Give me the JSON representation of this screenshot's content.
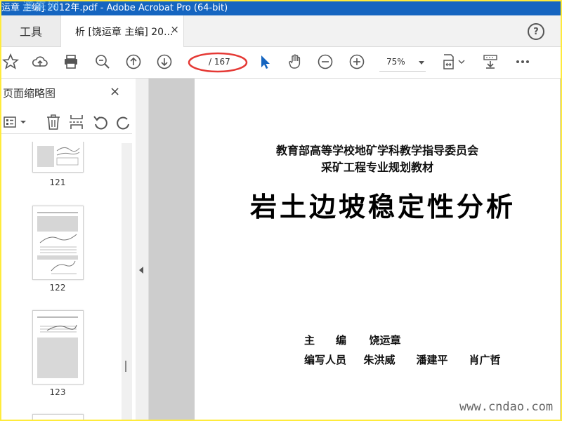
{
  "window": {
    "title": "运章 主编] 2012年.pdf - Adobe Acrobat Pro (64-bit)"
  },
  "watermarks": {
    "top": "道来网",
    "bottom": "www.cndao.com"
  },
  "tabs": {
    "tools_label": "工具",
    "doc_label": "析 [饶运章 主编] 20...",
    "close_glyph": "×",
    "help_glyph": "?"
  },
  "toolbar": {
    "current_page": "",
    "total_pages": "/ 167",
    "zoom": "75%",
    "icons": [
      "star-icon",
      "upload-cloud-icon",
      "print-icon",
      "zoom-out-search-icon",
      "previous-page-icon",
      "next-page-icon",
      "select-arrow-icon",
      "hand-icon",
      "zoom-out-icon",
      "zoom-in-icon",
      "page-fit-icon",
      "scroll-mode-icon",
      "more-icon"
    ]
  },
  "sidebar": {
    "title": "页面缩略图",
    "close_glyph": "×",
    "thumbnails": [
      {
        "label": "121"
      },
      {
        "label": "122"
      },
      {
        "label": "123"
      }
    ]
  },
  "page": {
    "subtitle_line1": "教育部高等学校地矿学科教学指导委员会",
    "subtitle_line2": "采矿工程专业规划教材",
    "title": "岩土边坡稳定性分析",
    "editor_label": "主　　编",
    "editor_name": "饶运章",
    "writers_label": "编写人员",
    "writers": "朱洪威　　潘建平　　肖广哲"
  },
  "colors": {
    "titlebar": "#1565c0",
    "frame": "#ffeb3b",
    "annotation_circle": "#e53935",
    "select_tool": "#1565c0"
  }
}
